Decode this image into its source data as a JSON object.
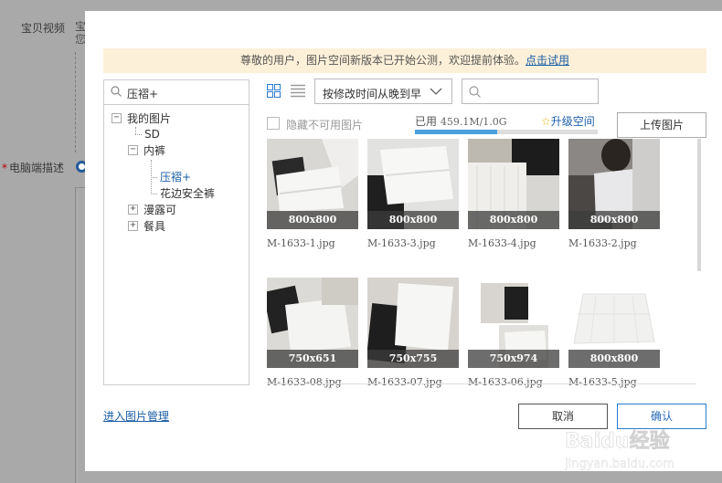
{
  "background": {
    "label_video": "宝贝视频",
    "label_video_right": "宝",
    "label_video_right2": "您",
    "label_desc": "电脑端描述",
    "required_mark": "*"
  },
  "dialog": {
    "notice_text": "尊敬的用户，图片空间新版本已开始公测，欢迎提前体验。",
    "notice_link": "点击试用",
    "tree_search_value": "压褶+",
    "tree": [
      {
        "label": "我的图片",
        "toggle": "−"
      },
      {
        "label": "SD"
      },
      {
        "label": "内裤",
        "toggle": "−"
      },
      {
        "label": "压褶+",
        "selected": true
      },
      {
        "label": "花边安全裤"
      },
      {
        "label": "漫露可",
        "toggle": "+"
      },
      {
        "label": "餐具",
        "toggle": "+"
      }
    ],
    "sort_value": "按修改时间从晚到早",
    "search_placeholder": "",
    "hide_unavailable": "隐藏不可用图片",
    "usage_prefix": "已用",
    "usage_value": "459.1M/1.0G",
    "usage_fraction": 0.45,
    "upgrade_label": "升级空间",
    "upload_label": "上传图片",
    "images": [
      {
        "name": "M-1633-1.jpg",
        "size": "800x800"
      },
      {
        "name": "M-1633-3.jpg",
        "size": "800x800"
      },
      {
        "name": "M-1633-4.jpg",
        "size": "800x800"
      },
      {
        "name": "M-1633-2.jpg",
        "size": "800x800"
      },
      {
        "name": "M-1633-08.jpg",
        "size": "750x651"
      },
      {
        "name": "M-1633-07.jpg",
        "size": "750x755"
      },
      {
        "name": "M-1633-06.jpg",
        "size": "750x974"
      },
      {
        "name": "M-1633-5.jpg",
        "size": "800x800"
      }
    ],
    "manage_link": "进入图片管理",
    "cancel_label": "取消",
    "ok_label": "确认"
  },
  "watermark": {
    "brand": "Baidu经验",
    "url": "jingyan.baidu.com"
  },
  "colors": {
    "accent": "#1a5ea8",
    "notice_bg": "#fdf0d8",
    "usage_fill": "#4a9fdc"
  }
}
